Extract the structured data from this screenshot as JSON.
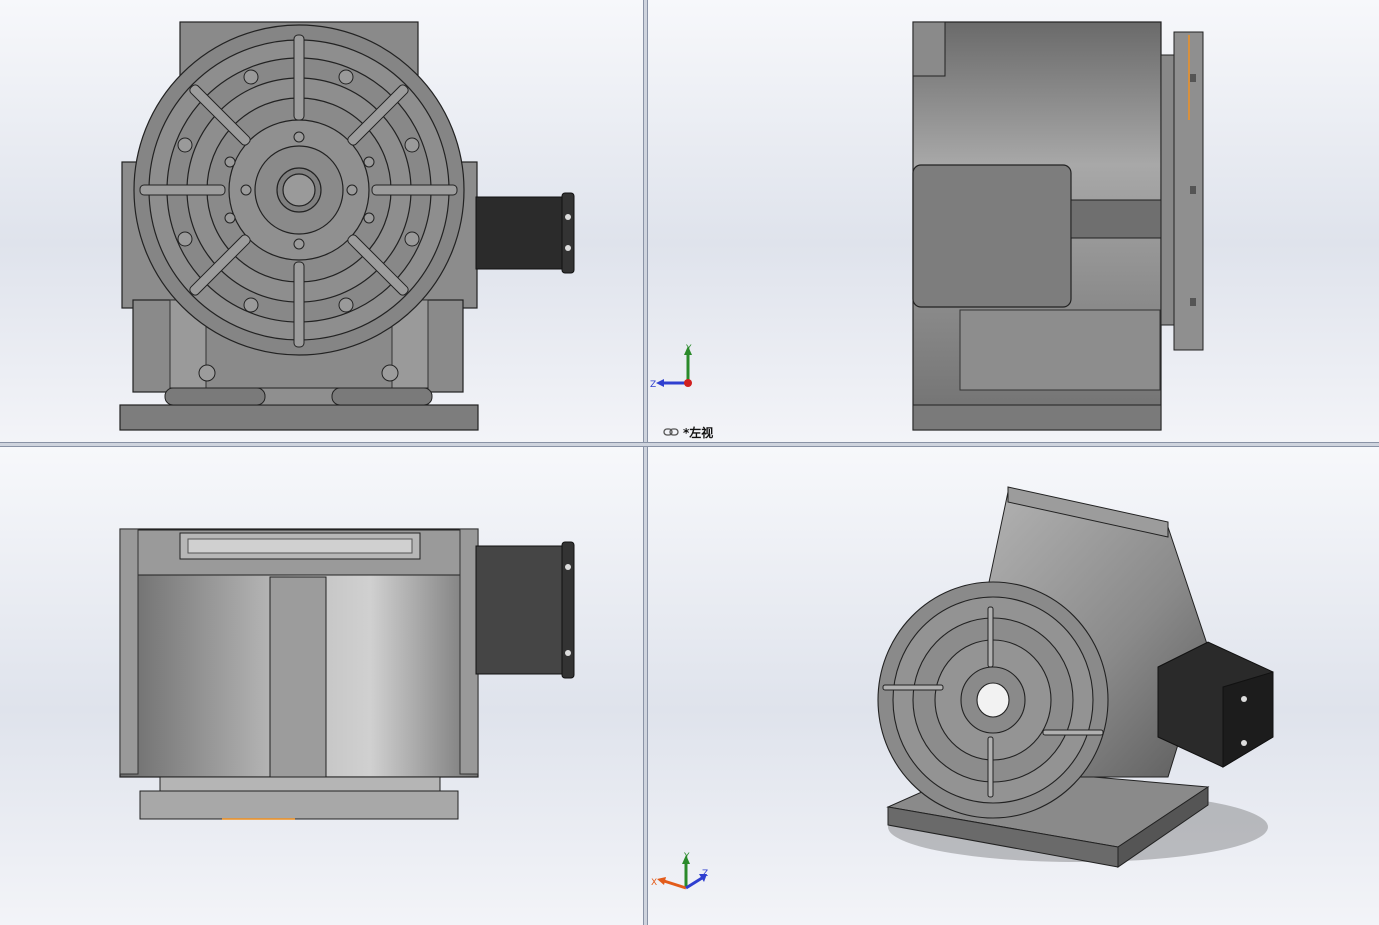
{
  "window": {
    "layout": "four-viewport"
  },
  "viewports": {
    "top_left": {
      "name": "front-view"
    },
    "top_right": {
      "name": "left-view",
      "label": "*左视",
      "triad": {
        "y_label": "Y",
        "z_label": "Z"
      }
    },
    "bottom_left": {
      "name": "top-view"
    },
    "bottom_right": {
      "name": "isometric-view",
      "triad": {
        "x_label": "X",
        "y_label": "Y",
        "z_label": "Z"
      }
    }
  },
  "colors": {
    "part_face": "#8f8f8f",
    "part_dark": "#5a5a5a",
    "motor": "#2b2b2b",
    "triad_x": "#e35b1a",
    "triad_y": "#2a8a2a",
    "triad_z": "#2f3fd0",
    "highlight": "#f09020"
  }
}
